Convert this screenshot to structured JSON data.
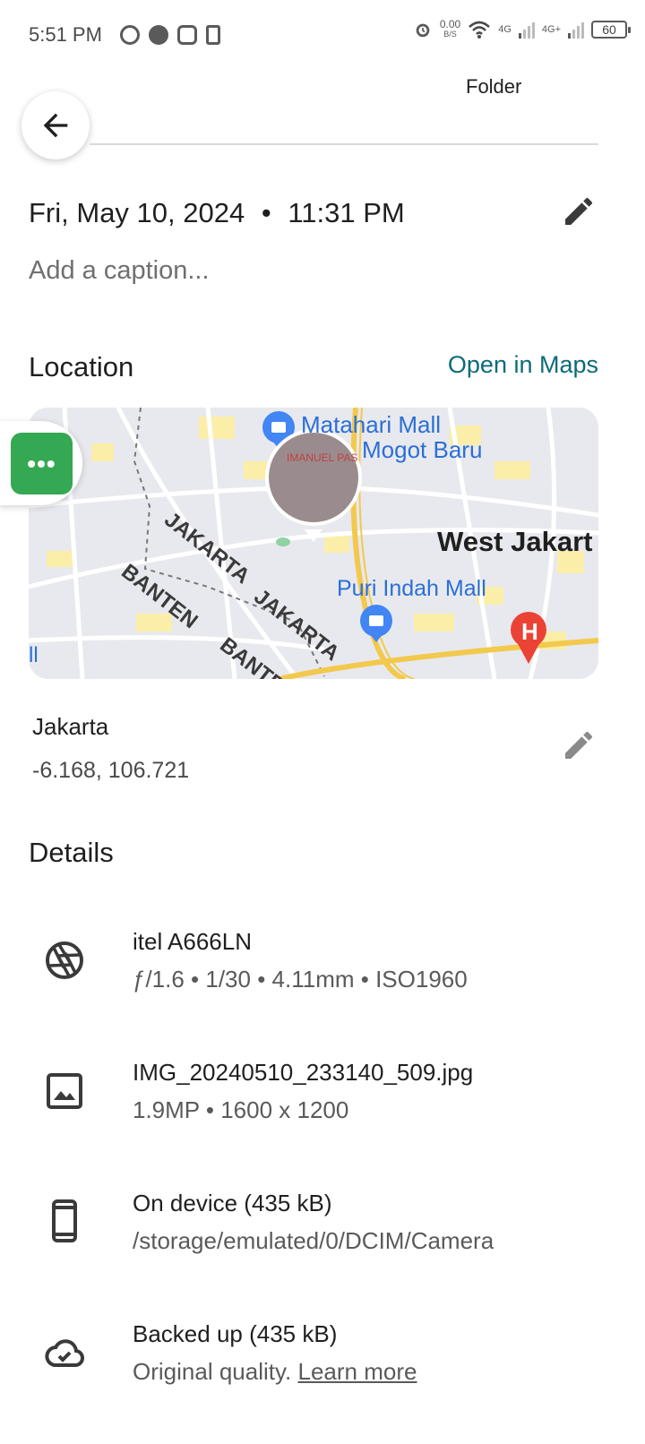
{
  "status_bar": {
    "time": "5:51 PM",
    "net_speed": "0.00",
    "net_unit": "B/S",
    "signal_1": "4G",
    "signal_2": "4G+",
    "battery": "60"
  },
  "header": {
    "folder_label": "Folder"
  },
  "info": {
    "date": "Fri, May 10, 2024",
    "time": "11:31 PM",
    "separator": "•",
    "caption_placeholder": "Add a caption..."
  },
  "location": {
    "section_title": "Location",
    "open_maps_label": "Open in Maps",
    "map_labels": {
      "mall_1": "Matahari Mall",
      "mall_1b": "Mogot Baru",
      "region_1": "JAKARTA",
      "region_2": "JAKARTA",
      "region_3": "BANTEN",
      "region_4": "BANTEN",
      "city": "West Jakart",
      "mall_2": "Puri Indah Mall",
      "pin_text": "IMANUEL PAS",
      "hospital_letter": "H",
      "edge_marker": "ll"
    },
    "place_name": "Jakarta",
    "coordinates": "-6.168, 106.721"
  },
  "details": {
    "section_title": "Details",
    "items": [
      {
        "icon": "camera-aperture-icon",
        "title": "itel A666LN",
        "subtitle": "ƒ/1.6 • 1/30 • 4.11mm • ISO1960"
      },
      {
        "icon": "image-icon",
        "title": "IMG_20240510_233140_509.jpg",
        "subtitle": "1.9MP • 1600 x 1200"
      },
      {
        "icon": "phone-icon",
        "title": "On device (435 kB)",
        "subtitle": "/storage/emulated/0/DCIM/Camera"
      },
      {
        "icon": "cloud-done-icon",
        "title": "Backed up (435 kB)",
        "subtitle": "Original quality.",
        "link": "Learn more"
      }
    ]
  },
  "colors": {
    "link": "#0b6b78",
    "chat_green": "#34a853",
    "pin_blue": "#4285f4",
    "hospital_red": "#ea4335"
  }
}
